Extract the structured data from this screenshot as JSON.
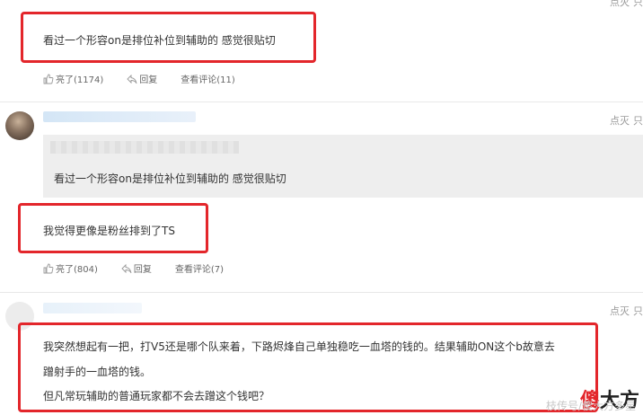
{
  "comments": [
    {
      "text": "看过一个形容on是排位补位到辅助的 感觉很贴切",
      "like_label": "亮了(1174)",
      "reply_label": "回复",
      "view_replies_label": "查看评论(11)",
      "corner_action": "点灭",
      "corner_extra": "只"
    },
    {
      "quoted_text": "看过一个形容on是排位补位到辅助的 感觉很贴切",
      "text": "我觉得更像是粉丝排到了TS",
      "like_label": "亮了(804)",
      "reply_label": "回复",
      "view_replies_label": "查看评论(7)",
      "corner_action": "点灭",
      "corner_extra": "只"
    },
    {
      "text_line1": "我突然想起有一把，打V5还是哪个队来着，下路烬烽自己单独稳吃一血塔的钱的。结果辅助ON这个b故意去",
      "text_line2": "蹭射手的一血塔的钱。",
      "text_line3": "但凡常玩辅助的普通玩家都不会去蹭这个钱吧？",
      "corner_action": "点灭",
      "corner_extra": "只"
    }
  ],
  "watermark": {
    "logo_char": "傻",
    "logo_rest": "大方",
    "source_text": "枝传号/傻大方多星"
  },
  "colors": {
    "highlight_red": "#e3262b",
    "quote_bg": "#eeeeee"
  },
  "icons": [
    "thumbs-up-icon",
    "reply-icon"
  ]
}
